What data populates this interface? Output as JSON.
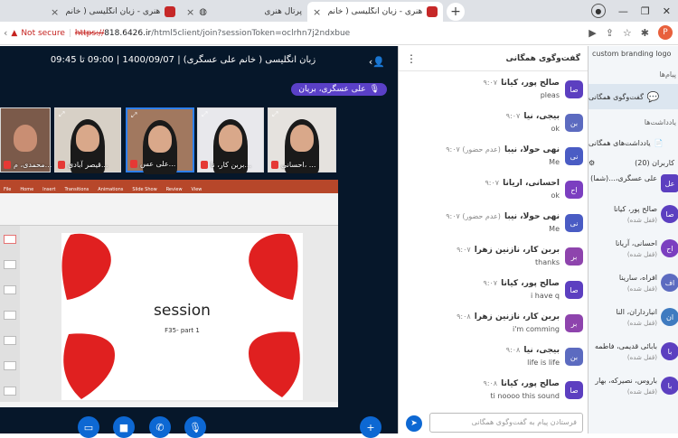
{
  "browser": {
    "tabs": [
      {
        "label": "هنری - زبان انگلیسی ( خانم علی عس...",
        "active": false,
        "close": "×"
      },
      {
        "label": "پرتال هنری",
        "active": false,
        "close": "×"
      },
      {
        "label": "هنری - زبان انگلیسی ( خانم های ه...",
        "active": true,
        "close": "×"
      }
    ],
    "new_tab": "+",
    "not_secure": "Not secure",
    "url_scheme": "https://",
    "url_domain": "818.6426.ir",
    "url_path": "/html5client/join?sessionToken=oclrhn7j2ndxbue",
    "profile_initial": "P"
  },
  "meeting": {
    "title": "زبان انگلیسی ( خانم علی عسگری) | 1400/09/07 | 09:00 تا 09:45",
    "presenter": "علی عسگری، بریان"
  },
  "thumbnails": [
    {
      "name": "محمدی، م..."
    },
    {
      "name": "قیصر آبادی..."
    },
    {
      "name": "علی عس..."
    },
    {
      "name": "بربن کار، نا..."
    },
    {
      "name": "احسانی، ..."
    }
  ],
  "presentation": {
    "ribbon_tabs": [
      "File",
      "Home",
      "Insert",
      "Transitions",
      "Animations",
      "Slide Show",
      "Review",
      "View"
    ],
    "slide_title": "session",
    "slide_subtitle": "F35- part 1"
  },
  "chat": {
    "header": "گفت‌وگوی همگانی",
    "menu_icon": "⋮",
    "messages": [
      {
        "initials": "صا",
        "name": "صالح پور، کیانا",
        "time": "۹:۰۷",
        "text": "pleas",
        "color": "#5c3fc0"
      },
      {
        "initials": "بن",
        "name": "بیجی، نیا",
        "time": "۹:۰۷",
        "text": "ok",
        "color": "#5c6bc0"
      },
      {
        "initials": "نی",
        "name": "نهی حولا، نیبا",
        "time": "(عدم حضور) ۹:۰۷",
        "text": "Me",
        "color": "#4a5cc4"
      },
      {
        "initials": "اح",
        "name": "احسانی، اریانا",
        "time": "۹:۰۷",
        "text": "ok",
        "color": "#7b3fc0"
      },
      {
        "initials": "نی",
        "name": "نهی حولا، نیبا",
        "time": "(عدم حضور) ۹:۰۷",
        "text": "Me",
        "color": "#4a5cc4"
      },
      {
        "initials": "بر",
        "name": "بربن کار، نازنین زهرا",
        "time": "۹:۰۷",
        "text": "thanks",
        "color": "#8e44ad"
      },
      {
        "initials": "صا",
        "name": "صالح پور، کیانا",
        "time": "۹:۰۷",
        "text": "i have q",
        "color": "#5c3fc0"
      },
      {
        "initials": "بر",
        "name": "بربن کار، نازنین زهرا",
        "time": "۹:۰۸",
        "text": "i'm comming",
        "color": "#8e44ad"
      },
      {
        "initials": "بن",
        "name": "بیجی، نیا",
        "time": "۹:۰۸",
        "text": "life is life",
        "color": "#5c6bc0"
      },
      {
        "initials": "صا",
        "name": "صالح پور، کیانا",
        "time": "۹:۰۸",
        "text": "ti noooo this sound",
        "color": "#5c3fc0"
      }
    ],
    "input_placeholder": "فرستادن پیام به گفت‌وگوی همگانی"
  },
  "sidebar": {
    "branding": "custom branding logo",
    "section_messages": "پیام‌ها",
    "public_chat": "گفت‌وگوی همگانی",
    "section_notes": "یادداشت‌ها",
    "shared_notes": "یادداشت‌های همگانی",
    "users_header": "کاربران (20)",
    "users": [
      {
        "initials": "عل",
        "name": "علی عسگری،...(شما)",
        "status": "",
        "color": "#5c3fc0"
      },
      {
        "initials": "صا",
        "name": "صالح پور، کیانا",
        "status": "(قفل شده)",
        "color": "#5c3fc0"
      },
      {
        "initials": "اح",
        "name": "احسانی، آریانا",
        "status": "(قفل شده)",
        "color": "#7b3fc0"
      },
      {
        "initials": "اف",
        "name": "افراه، سارینا",
        "status": "(قفل شده)",
        "color": "#5c6bc0"
      },
      {
        "initials": "ان",
        "name": "انبارداران، النا",
        "status": "(قفل شده)",
        "color": "#3f7bc0"
      },
      {
        "initials": "با",
        "name": "بابائی قدیمی، فاطمه",
        "status": "(قفل شده)",
        "color": "#5c3fc0"
      },
      {
        "initials": "با",
        "name": "باروس، نصیرکه، بهار",
        "status": "(قفل شده)",
        "color": "#5c3fc0"
      }
    ]
  }
}
